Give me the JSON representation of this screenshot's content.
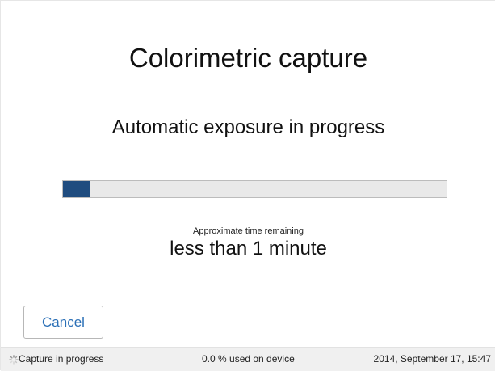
{
  "title": "Colorimetric capture",
  "subtitle": "Automatic exposure in progress",
  "progress": {
    "value_percent": 7,
    "fill_color": "#1f4c7f"
  },
  "time_remaining": {
    "label": "Approximate time remaining",
    "value": "less than 1 minute"
  },
  "cancel_label": "Cancel",
  "status": {
    "icon": "spinner-icon",
    "activity": "Capture in progress",
    "storage": "0.0 % used on device",
    "datetime": "2014, September 17, 15:47"
  },
  "colors": {
    "accent": "#2a6fb6",
    "progress_fill": "#1f4c7f"
  }
}
